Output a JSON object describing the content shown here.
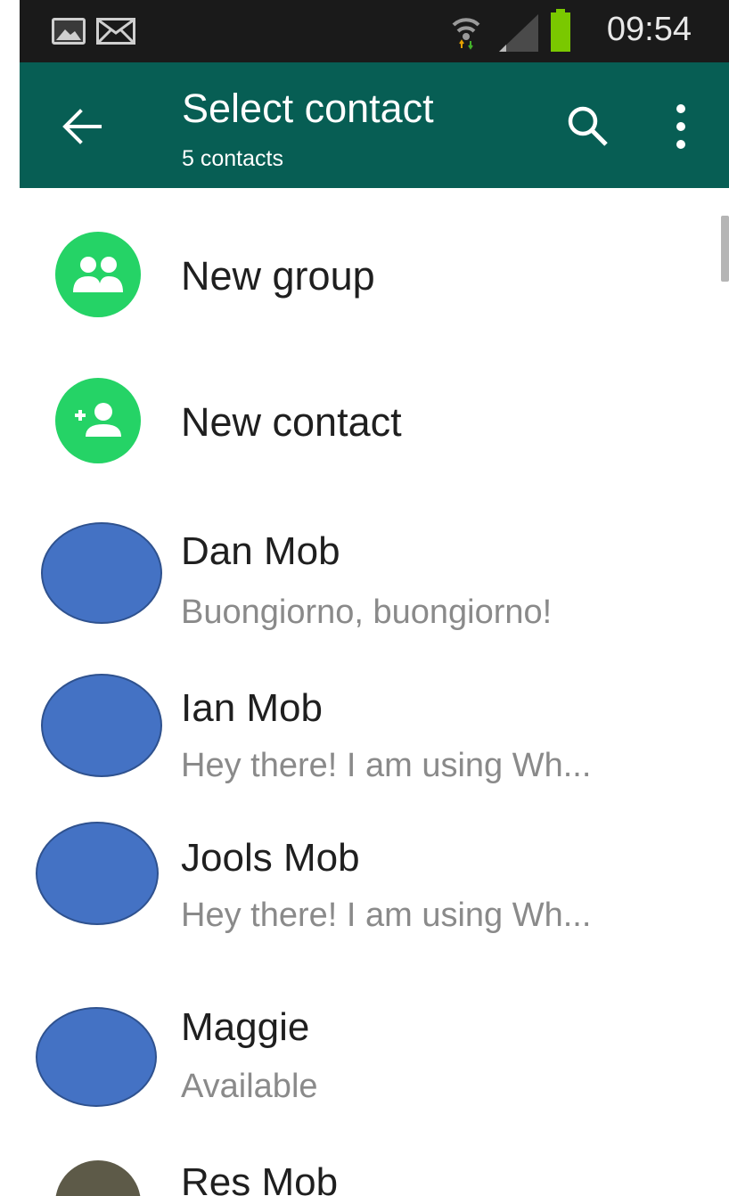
{
  "status_bar": {
    "time": "09:54"
  },
  "app_bar": {
    "title": "Select contact",
    "subtitle": "5 contacts"
  },
  "actions": [
    {
      "label": "New group"
    },
    {
      "label": "New contact"
    }
  ],
  "contacts": [
    {
      "name": "Dan Mob",
      "status": "Buongiorno, buongiorno!"
    },
    {
      "name": "Ian Mob",
      "status": "Hey there! I am using Wh..."
    },
    {
      "name": "Jools Mob",
      "status": "Hey there! I am using Wh..."
    },
    {
      "name": "Maggie",
      "status": "Available"
    },
    {
      "name": "Res Mob",
      "status": ""
    }
  ],
  "colors": {
    "app_bar": "#075e54",
    "action_icon": "#25d366",
    "avatar_placeholder": "#4472c4"
  }
}
